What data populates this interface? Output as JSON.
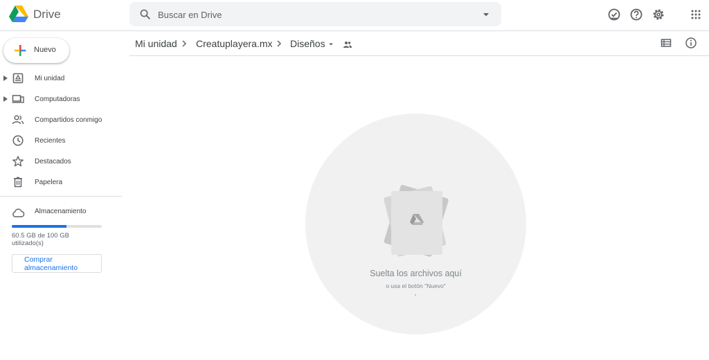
{
  "header": {
    "app_name": "Drive",
    "search_placeholder": "Buscar en Drive",
    "icons": [
      "offline-check-icon",
      "help-icon",
      "settings-icon",
      "apps-grid-icon"
    ]
  },
  "sidebar": {
    "new_button_label": "Nuevo",
    "items": [
      {
        "label": "Mi unidad",
        "icon": "my-drive-icon",
        "expandable": true
      },
      {
        "label": "Computadoras",
        "icon": "computers-icon",
        "expandable": true
      },
      {
        "label": "Compartidos conmigo",
        "icon": "shared-icon",
        "expandable": false
      },
      {
        "label": "Recientes",
        "icon": "clock-icon",
        "expandable": false
      },
      {
        "label": "Destacados",
        "icon": "star-icon",
        "expandable": false
      },
      {
        "label": "Papelera",
        "icon": "trash-icon",
        "expandable": false
      }
    ],
    "storage": {
      "label": "Almacenamiento",
      "usage_text": "60.5 GB de 100 GB utilizado(s)",
      "used_fraction": 0.605,
      "buy_label": "Comprar almacenamiento"
    }
  },
  "breadcrumb": {
    "items": [
      "Mi unidad",
      "Creatuplayera.mx",
      "Diseños"
    ]
  },
  "empty_state": {
    "title": "Suelta los archivos aquí",
    "subtitle": "o usa el botón \"Nuevo\""
  },
  "colors": {
    "accent": "#1a73e8",
    "drop_zone_bg": "#f1f1f1"
  }
}
